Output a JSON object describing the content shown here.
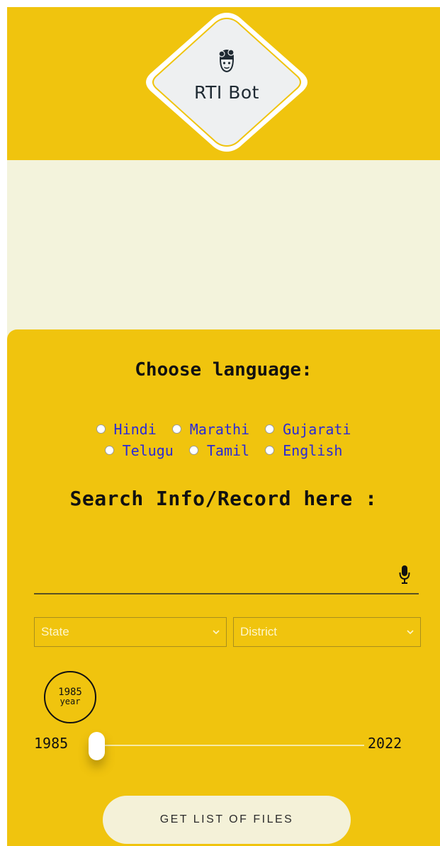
{
  "app": {
    "logo_text": "RTI Bot"
  },
  "language": {
    "heading": "Choose language:",
    "options": [
      "Hindi",
      "Marathi",
      "Gujarati",
      "Telugu",
      "Tamil",
      "English"
    ],
    "selected": null
  },
  "search": {
    "heading": "Search Info/Record here :",
    "value": "",
    "placeholder": ""
  },
  "filters": {
    "state_label": "State",
    "district_label": "District"
  },
  "year_slider": {
    "current_value": "1985",
    "current_unit": "year",
    "min": "1985",
    "max": "2022",
    "value": 1985
  },
  "actions": {
    "get_files_label": "GET LIST OF FILES"
  },
  "colors": {
    "primary_yellow": "#f0c40e",
    "cream": "#f3f3dc",
    "link_blue": "#2a2ad8"
  }
}
